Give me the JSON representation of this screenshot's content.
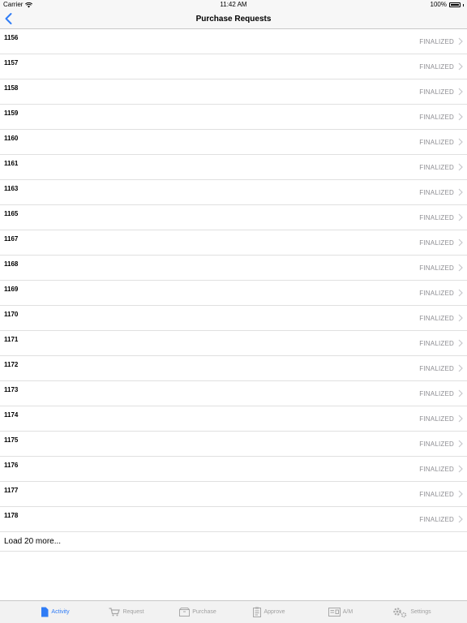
{
  "status_bar": {
    "carrier": "Carrier",
    "time": "11:42 AM",
    "battery": "100%"
  },
  "nav": {
    "title": "Purchase Requests"
  },
  "colors": {
    "accent": "#2f7cf6",
    "status_gray": "#8e8e93"
  },
  "rows": [
    {
      "id": "1156",
      "status": "FINALIZED"
    },
    {
      "id": "1157",
      "status": "FINALIZED"
    },
    {
      "id": "1158",
      "status": "FINALIZED"
    },
    {
      "id": "1159",
      "status": "FINALIZED"
    },
    {
      "id": "1160",
      "status": "FINALIZED"
    },
    {
      "id": "1161",
      "status": "FINALIZED"
    },
    {
      "id": "1163",
      "status": "FINALIZED"
    },
    {
      "id": "1165",
      "status": "FINALIZED"
    },
    {
      "id": "1167",
      "status": "FINALIZED"
    },
    {
      "id": "1168",
      "status": "FINALIZED"
    },
    {
      "id": "1169",
      "status": "FINALIZED"
    },
    {
      "id": "1170",
      "status": "FINALIZED"
    },
    {
      "id": "1171",
      "status": "FINALIZED"
    },
    {
      "id": "1172",
      "status": "FINALIZED"
    },
    {
      "id": "1173",
      "status": "FINALIZED"
    },
    {
      "id": "1174",
      "status": "FINALIZED"
    },
    {
      "id": "1175",
      "status": "FINALIZED"
    },
    {
      "id": "1176",
      "status": "FINALIZED"
    },
    {
      "id": "1177",
      "status": "FINALIZED"
    },
    {
      "id": "1178",
      "status": "FINALIZED"
    }
  ],
  "load_more": "Load 20 more...",
  "tabs": [
    {
      "label": "Activity",
      "icon": "document-icon",
      "active": true
    },
    {
      "label": "Request",
      "icon": "cart-icon",
      "active": false
    },
    {
      "label": "Purchase",
      "icon": "box-icon",
      "active": false
    },
    {
      "label": "Approve",
      "icon": "clipboard-icon",
      "active": false
    },
    {
      "label": "A/M",
      "icon": "invoice-icon",
      "active": false
    },
    {
      "label": "Settings",
      "icon": "gear-icon",
      "active": false
    }
  ]
}
